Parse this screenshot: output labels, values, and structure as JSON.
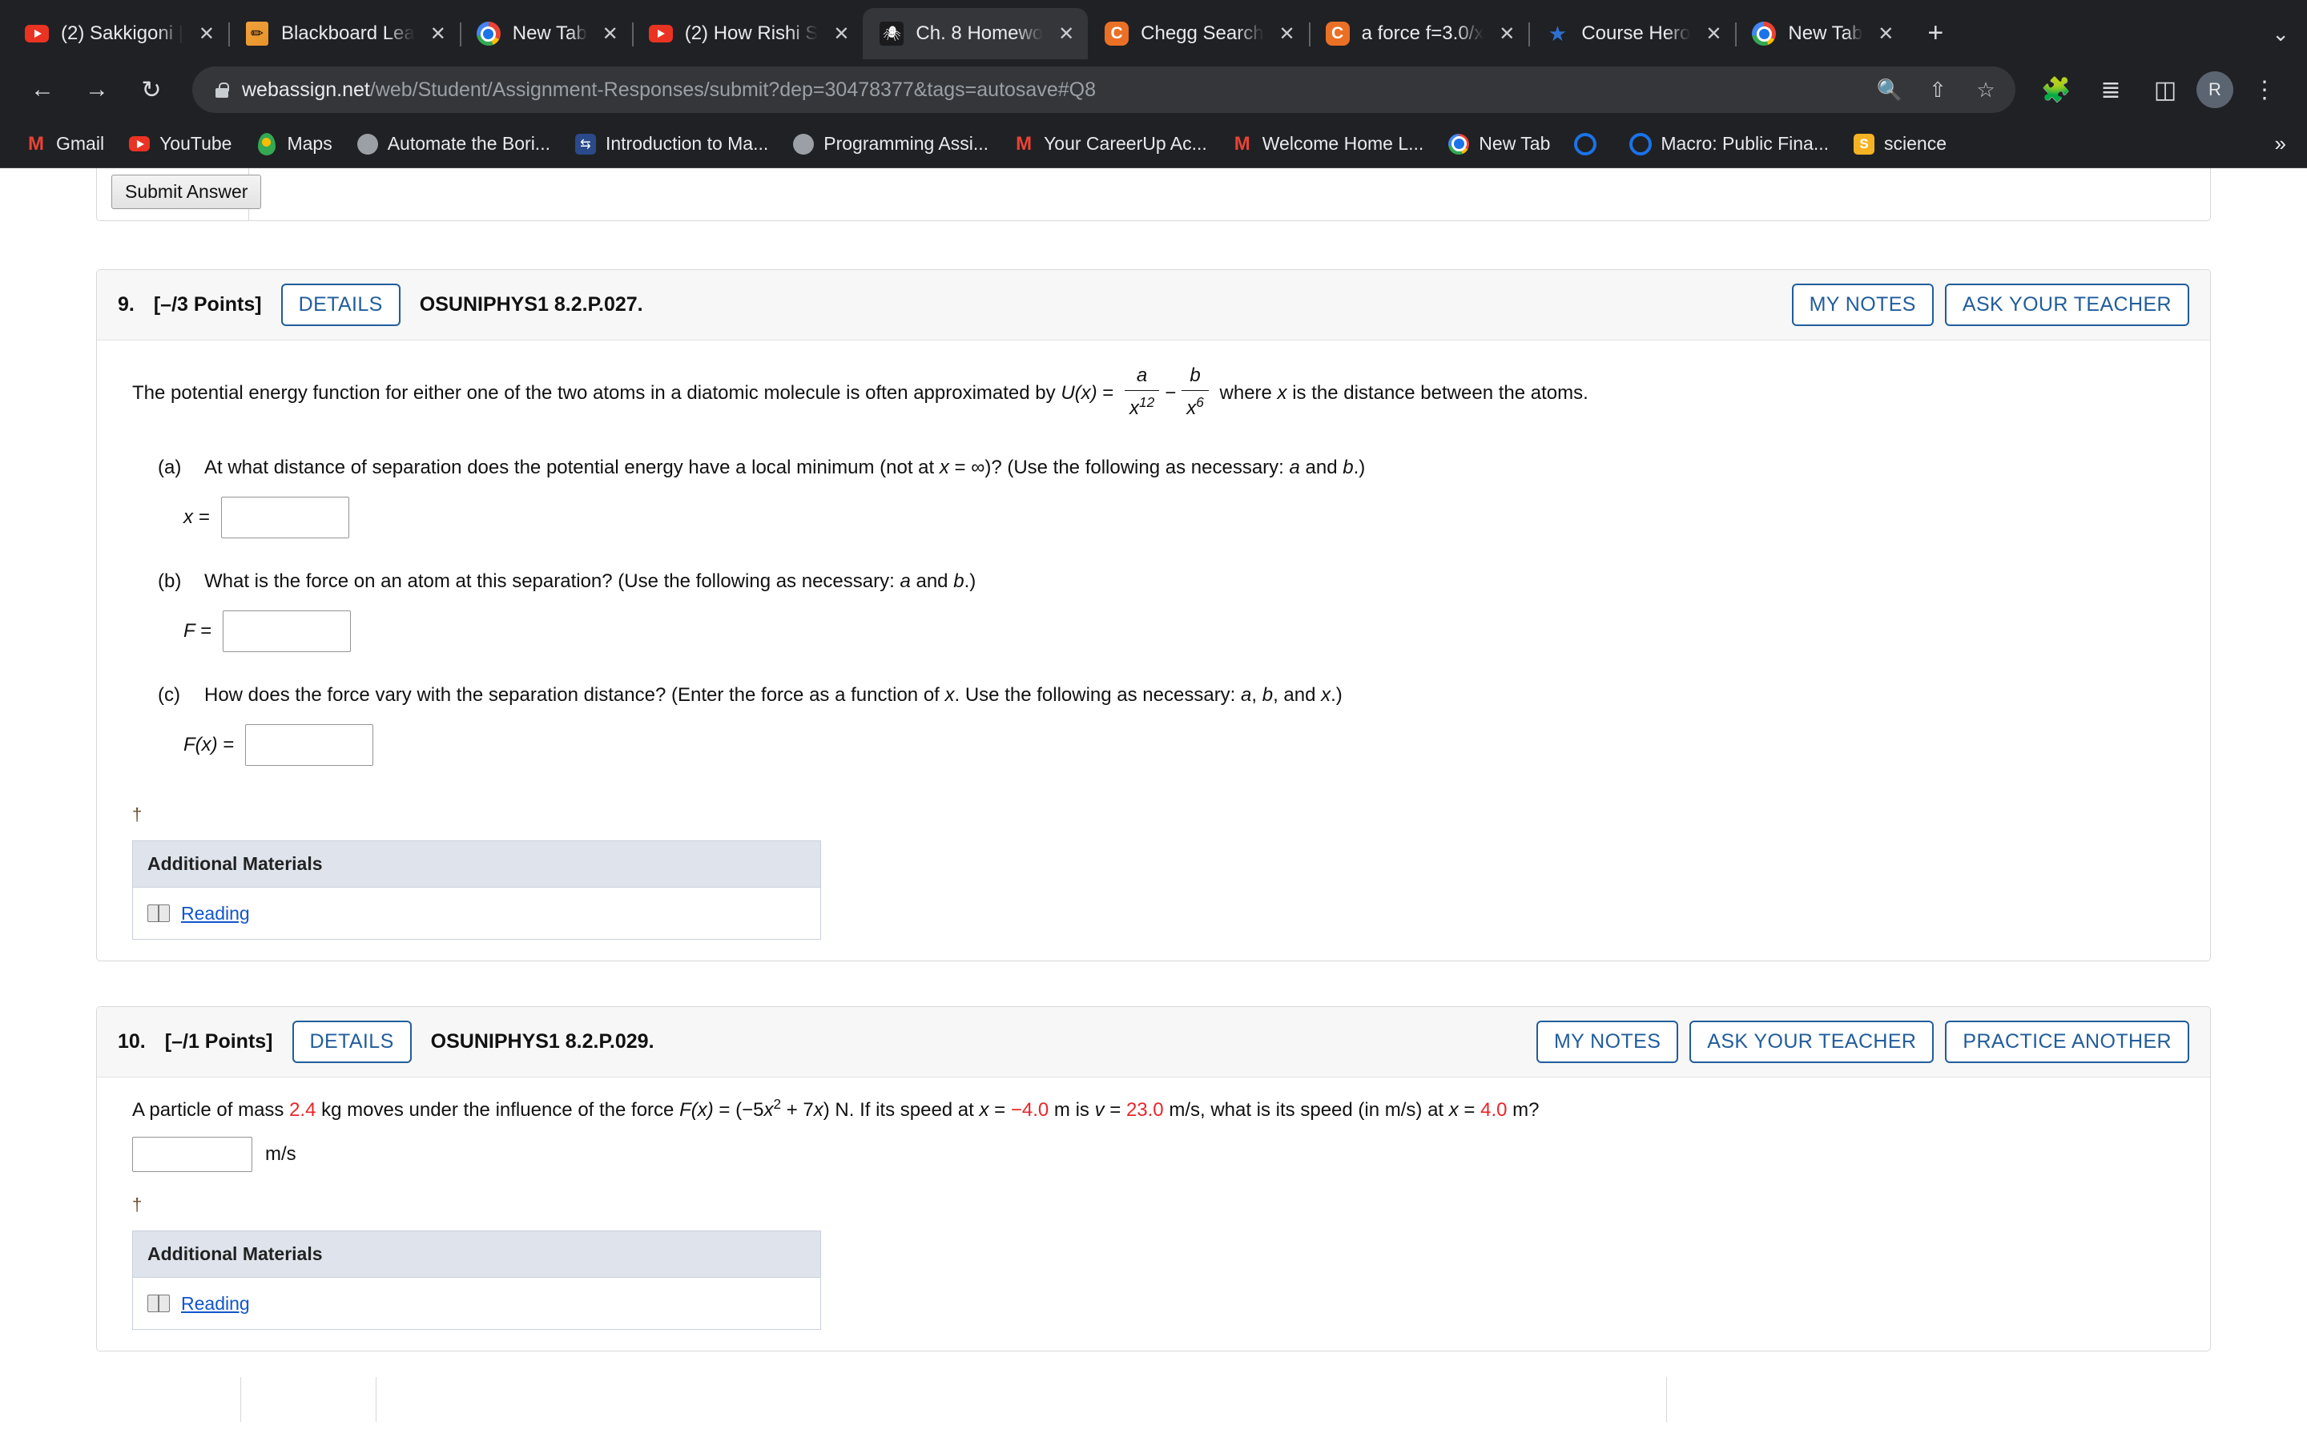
{
  "browser": {
    "tabs": [
      {
        "title": "(2) Sakkigoni |",
        "icon": "youtube-icon",
        "active": false
      },
      {
        "title": "Blackboard Lea",
        "icon": "blackboard-icon",
        "active": false
      },
      {
        "title": "New Tab",
        "icon": "chrome-icon",
        "active": false
      },
      {
        "title": "(2) How Rishi S",
        "icon": "youtube-icon",
        "active": false
      },
      {
        "title": "Ch. 8 Homewo",
        "icon": "webassign-icon",
        "active": true
      },
      {
        "title": "Chegg Search",
        "icon": "chegg-icon",
        "active": false
      },
      {
        "title": "a force f=3.0/x",
        "icon": "chegg-icon",
        "active": false
      },
      {
        "title": "Course Hero",
        "icon": "star-icon",
        "active": false
      },
      {
        "title": "New Tab",
        "icon": "chrome-icon",
        "active": false
      }
    ],
    "new_tab_label": "+",
    "tab_list_chevron": "⌄",
    "nav": {
      "back": "←",
      "forward": "→",
      "reload": "↻",
      "url_domain": "webassign.net",
      "url_path": "/web/Student/Assignment-Responses/submit?dep=30478377&tags=autosave#Q8",
      "zoom_icon": "search-icon",
      "share_icon": "share-icon",
      "bookmark_icon": "star-icon",
      "extensions_icon": "puzzle-icon",
      "reading_list_icon": "reading-list-icon",
      "sidepanel_icon": "sidepanel-icon",
      "profile_initial": "R",
      "menu_icon": "kebab-menu-icon"
    },
    "bookmarks": [
      {
        "label": "Gmail",
        "icon": "gmail-icon"
      },
      {
        "label": "YouTube",
        "icon": "youtube-icon"
      },
      {
        "label": "Maps",
        "icon": "maps-icon"
      },
      {
        "label": "Automate the Bori...",
        "icon": "globe-icon"
      },
      {
        "label": "Introduction to Ma...",
        "icon": "book-icon"
      },
      {
        "label": "Programming Assi...",
        "icon": "globe-icon"
      },
      {
        "label": "Your CareerUp Ac...",
        "icon": "gmail-icon"
      },
      {
        "label": "Welcome Home L...",
        "icon": "gmail-icon"
      },
      {
        "label": "New Tab",
        "icon": "chrome-icon"
      },
      {
        "label": "",
        "icon": "quizlet-icon"
      },
      {
        "label": "Macro: Public Fina...",
        "icon": "quora-icon"
      },
      {
        "label": "science",
        "icon": "scholar-icon"
      }
    ],
    "bookmarks_overflow": "»"
  },
  "top": {
    "submit_label": "Submit Answer"
  },
  "q9": {
    "number": "9.",
    "points": "[–/3 Points]",
    "details_label": "DETAILS",
    "code": "OSUNIPHYS1 8.2.P.027.",
    "my_notes": "MY NOTES",
    "ask_teacher": "ASK YOUR TEACHER",
    "intro_1": "The potential energy function for either one of the two atoms in a diatomic molecule is often approximated by ",
    "intro_fn": "U(x)",
    "intro_eq": " = ",
    "frac1_num": "a",
    "frac1_den_base": "x",
    "frac1_den_exp": "12",
    "minus": "−",
    "frac2_num": "b",
    "frac2_den_base": "x",
    "frac2_den_exp": "6",
    "intro_2a": " where ",
    "intro_2b": "x",
    "intro_2c": " is the distance between the atoms.",
    "parts": [
      {
        "label": "(a)",
        "text_1": "At what distance of separation does the potential energy have a local minimum (not at ",
        "var_x": "x",
        "text_2": " = ∞)? (Use the following as necessary: ",
        "var_a": "a",
        "text_3": " and ",
        "var_b": "b",
        "text_4": ".)",
        "answer_label": "x =",
        "answer_value": ""
      },
      {
        "label": "(b)",
        "text_1": "What is the force on an atom at this separation? (Use the following as necessary: ",
        "var_a": "a",
        "text_3": " and ",
        "var_b": "b",
        "text_4": ".)",
        "answer_label": "F =",
        "answer_value": ""
      },
      {
        "label": "(c)",
        "text_1": "How does the force vary with the separation distance? (Enter the force as a function of ",
        "var_x": "x",
        "text_2": ". Use the following as necessary: ",
        "var_a": "a",
        "text_3": ", ",
        "var_b": "b",
        "text_3b": ", and ",
        "var_x2": "x",
        "text_4": ".)",
        "answer_label_fn": "F(x)",
        "answer_label_eq": " =",
        "answer_value": ""
      }
    ],
    "dagger": "†",
    "materials_title": "Additional Materials",
    "materials_link": "Reading"
  },
  "q10": {
    "number": "10.",
    "points": "[–/1 Points]",
    "details_label": "DETAILS",
    "code": "OSUNIPHYS1 8.2.P.029.",
    "my_notes": "MY NOTES",
    "ask_teacher": "ASK YOUR TEACHER",
    "practice_another": "PRACTICE ANOTHER",
    "text_1": "A particle of mass ",
    "mass": "2.4",
    "text_2": " kg moves under the influence of the force ",
    "force_fn": "F(x)",
    "force_eq": " = (−5",
    "force_x": "x",
    "force_exp": "2",
    "force_rest": " + 7",
    "force_x2": "x",
    "force_tail": ") N. If its speed at ",
    "var_x": "x",
    "text_3": " = ",
    "x_initial": "−4.0",
    "text_4": " m is ",
    "var_v": "v",
    "text_5": " = ",
    "v_initial": "23.0",
    "text_6": " m/s, what is its speed (in m/s) at ",
    "var_x2": "x",
    "text_7": " = ",
    "x_final": "4.0",
    "text_8": " m?",
    "answer_value": "",
    "answer_unit": "m/s",
    "dagger": "†",
    "materials_title": "Additional Materials",
    "materials_link": "Reading"
  }
}
